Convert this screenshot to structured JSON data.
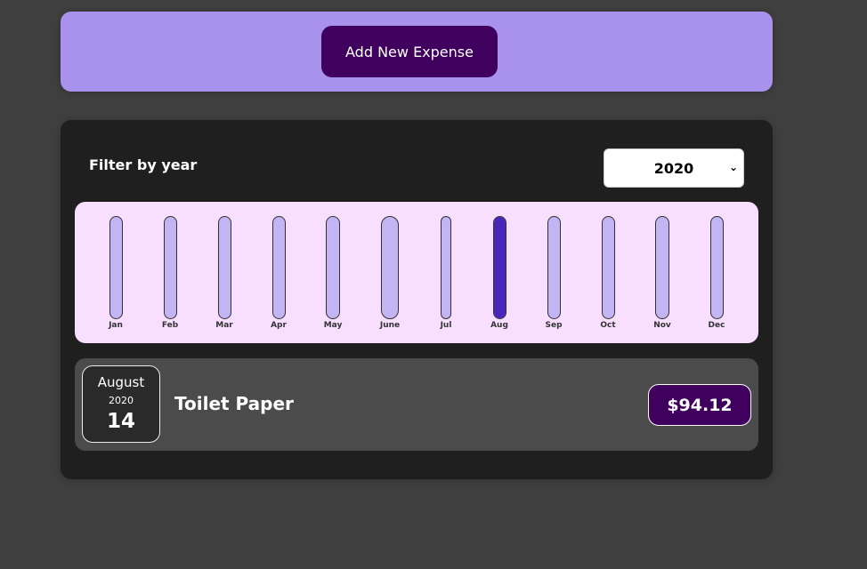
{
  "new_expense": {
    "add_button_label": "Add New Expense"
  },
  "filter": {
    "label": "Filter by year",
    "selected_year": "2020"
  },
  "chart_data": {
    "type": "bar",
    "categories": [
      "Jan",
      "Feb",
      "Mar",
      "Apr",
      "May",
      "June",
      "Jul",
      "Aug",
      "Sep",
      "Oct",
      "Nov",
      "Dec"
    ],
    "values": [
      0,
      0,
      0,
      0,
      0,
      0,
      0,
      94.12,
      0,
      0,
      0,
      0
    ],
    "ylim": [
      0,
      94.12
    ],
    "grid": false,
    "colors": {
      "bar_bg": "#c3b4f3",
      "bar_fill": "#4826b9",
      "panel": "#f8dfff"
    }
  },
  "expenses": [
    {
      "month": "August",
      "year": "2020",
      "day": "14",
      "title": "Toilet Paper",
      "amount": "$94.12"
    }
  ],
  "colors": {
    "page_bg": "#3f3f3f",
    "new_expense_bg": "#a892ee",
    "accent": "#40005d",
    "expenses_bg": "#1f1f1f",
    "item_bg": "#4b4b4b"
  }
}
